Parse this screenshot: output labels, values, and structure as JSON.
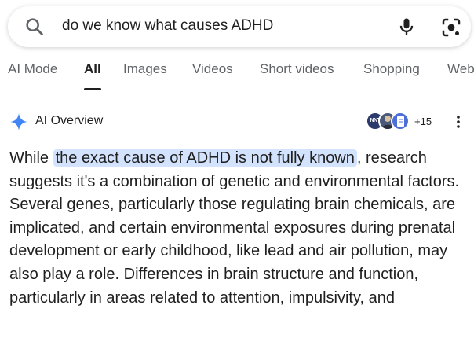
{
  "search": {
    "query": "do we know what causes ADHD",
    "icons": {
      "search": "search-icon",
      "mic": "mic-icon",
      "lens": "lens-icon"
    }
  },
  "tabs": [
    {
      "label": "AI Mode",
      "active": false
    },
    {
      "label": "All",
      "active": true
    },
    {
      "label": "Images",
      "active": false
    },
    {
      "label": "Videos",
      "active": false
    },
    {
      "label": "Short videos",
      "active": false
    },
    {
      "label": "Shopping",
      "active": false
    },
    {
      "label": "Web",
      "active": false
    }
  ],
  "ai_overview": {
    "title": "AI Overview",
    "source_badge": "NNT",
    "source_count": "+15",
    "answer": {
      "prefix": "While ",
      "highlight": "the exact cause of ADHD is not fully known",
      "suffix": ", research suggests it's a combination of genetic and environmental factors. Several genes, particularly those regulating brain chemicals, are implicated, and certain environmental exposures during prenatal development or early childhood, like lead and air pollution, may also play a role. Differences in brain structure and function, particularly in areas related to attention, impulsivity, and"
    }
  },
  "colors": {
    "highlight": "#d3e3fd",
    "sparkle": "#4285f4",
    "muted": "#5f6368"
  }
}
